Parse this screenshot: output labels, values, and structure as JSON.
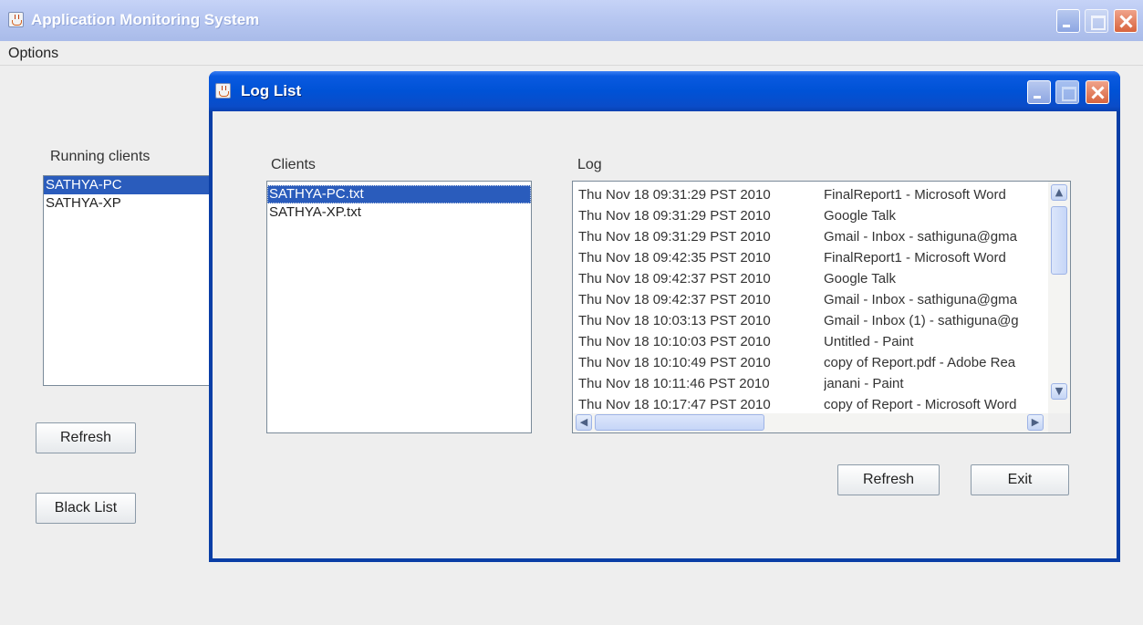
{
  "main_window": {
    "title": "Application Monitoring System",
    "menu": {
      "options_label": "Options"
    },
    "running_clients_label": "Running clients",
    "running_clients": [
      {
        "name": "SATHYA-PC",
        "selected": true
      },
      {
        "name": "SATHYA-XP",
        "selected": false
      }
    ],
    "refresh_label": "Refresh",
    "blacklist_label": "Black List"
  },
  "dialog": {
    "title": "Log List",
    "clients_label": "Clients",
    "clients": [
      {
        "name": "SATHYA-PC.txt",
        "selected": true
      },
      {
        "name": "SATHYA-XP.txt",
        "selected": false
      }
    ],
    "log_label": "Log",
    "log_entries": [
      {
        "date": "Thu Nov 18 09:31:29 PST 2010",
        "app": "FinalReport1 - Microsoft Word"
      },
      {
        "date": "Thu Nov 18 09:31:29 PST 2010",
        "app": "Google Talk"
      },
      {
        "date": "Thu Nov 18 09:31:29 PST 2010",
        "app": "Gmail - Inbox - sathiguna@gma"
      },
      {
        "date": "Thu Nov 18 09:42:35 PST 2010",
        "app": "FinalReport1 - Microsoft Word"
      },
      {
        "date": "Thu Nov 18 09:42:37 PST 2010",
        "app": "Google Talk"
      },
      {
        "date": "Thu Nov 18 09:42:37 PST 2010",
        "app": "Gmail - Inbox - sathiguna@gma"
      },
      {
        "date": "Thu Nov 18 10:03:13 PST 2010",
        "app": "Gmail - Inbox (1) - sathiguna@g"
      },
      {
        "date": "Thu Nov 18 10:10:03 PST 2010",
        "app": "Untitled - Paint"
      },
      {
        "date": "Thu Nov 18 10:10:49 PST 2010",
        "app": "copy of Report.pdf - Adobe Rea"
      },
      {
        "date": "Thu Nov 18 10:11:46 PST 2010",
        "app": "janani - Paint"
      },
      {
        "date": "Thu Nov 18 10:17:47 PST 2010",
        "app": "copy of Report - Microsoft Word"
      }
    ],
    "refresh_label": "Refresh",
    "exit_label": "Exit"
  },
  "colors": {
    "selection": "#2a5cbc",
    "dialog_titlebar": "#0052d6",
    "main_titlebar_inactive": "#b7c7f1",
    "window_background": "#eeeeee"
  },
  "icons": [
    "java-cup-icon",
    "minimize-icon",
    "maximize-icon",
    "close-icon",
    "scroll-up-arrow-icon",
    "scroll-down-arrow-icon",
    "scroll-left-arrow-icon",
    "scroll-right-arrow-icon"
  ]
}
